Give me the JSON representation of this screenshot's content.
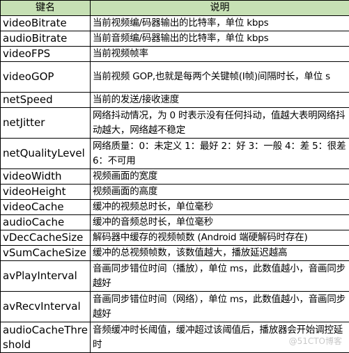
{
  "table": {
    "headers": {
      "key": "键名",
      "description": "说明"
    },
    "rows": [
      {
        "key": "videoBitrate",
        "description": "当前视频编/码器输出的比特率，单位 kbps",
        "lines": 1
      },
      {
        "key": "audioBitrate",
        "description": "当前音频编/码器输出的比特率，单位 kbps",
        "lines": 1
      },
      {
        "key": "videoFPS",
        "description": "当前视频帧率",
        "lines": 1
      },
      {
        "key": "videoGOP",
        "description": "当前视频 GOP,也就是每两个关键帧(I帧)间隔时长，单位 s",
        "lines": 2
      },
      {
        "key": "netSpeed",
        "description": "当前的发送/接收速度",
        "lines": 1
      },
      {
        "key": "netJitter",
        "description": "网络抖动情况，为 0 时表示没有任何抖动，值越大表明网络抖动越大，网络越不稳定",
        "lines": 2
      },
      {
        "key": "netQualityLevel",
        "description": "网络质量：0：未定义 1：最好 2：好 3：一般 4：差 5：很差 6：不可用",
        "lines": 2
      },
      {
        "key": "videoWidth",
        "description": "视频画面的宽度",
        "lines": 1
      },
      {
        "key": "videoHeight",
        "description": "视频画面的高度",
        "lines": 1
      },
      {
        "key": "videoCache",
        "description": "缓冲的视频总时长，单位毫秒",
        "lines": 1
      },
      {
        "key": "audioCache",
        "description": "缓冲的音频总时长，单位毫秒",
        "lines": 1
      },
      {
        "key": "vDecCacheSize",
        "description": "解码器中缓存的视频帧数 (Android 端硬解码时存在)",
        "lines": 1
      },
      {
        "key": "vSumCacheSize",
        "description": "缓冲的总视频帧数，该数值越大，播放延迟越高",
        "lines": 1
      },
      {
        "key": "avPlayInterval",
        "description": "音画同步错位时间（播放），单位 ms，此数值越小，音画同步越好",
        "lines": 2
      },
      {
        "key": "avRecvInterval",
        "description": "音画同步错位时间（网络），单位 ms，此数值越小，音画同步越好",
        "lines": 2
      },
      {
        "key": "audioCacheThreshold",
        "description": "音频缓冲时长阈值，缓冲超过该阈值后，播放器会开始调控延时",
        "lines": 2
      }
    ]
  },
  "watermark": "@51CTO博客"
}
